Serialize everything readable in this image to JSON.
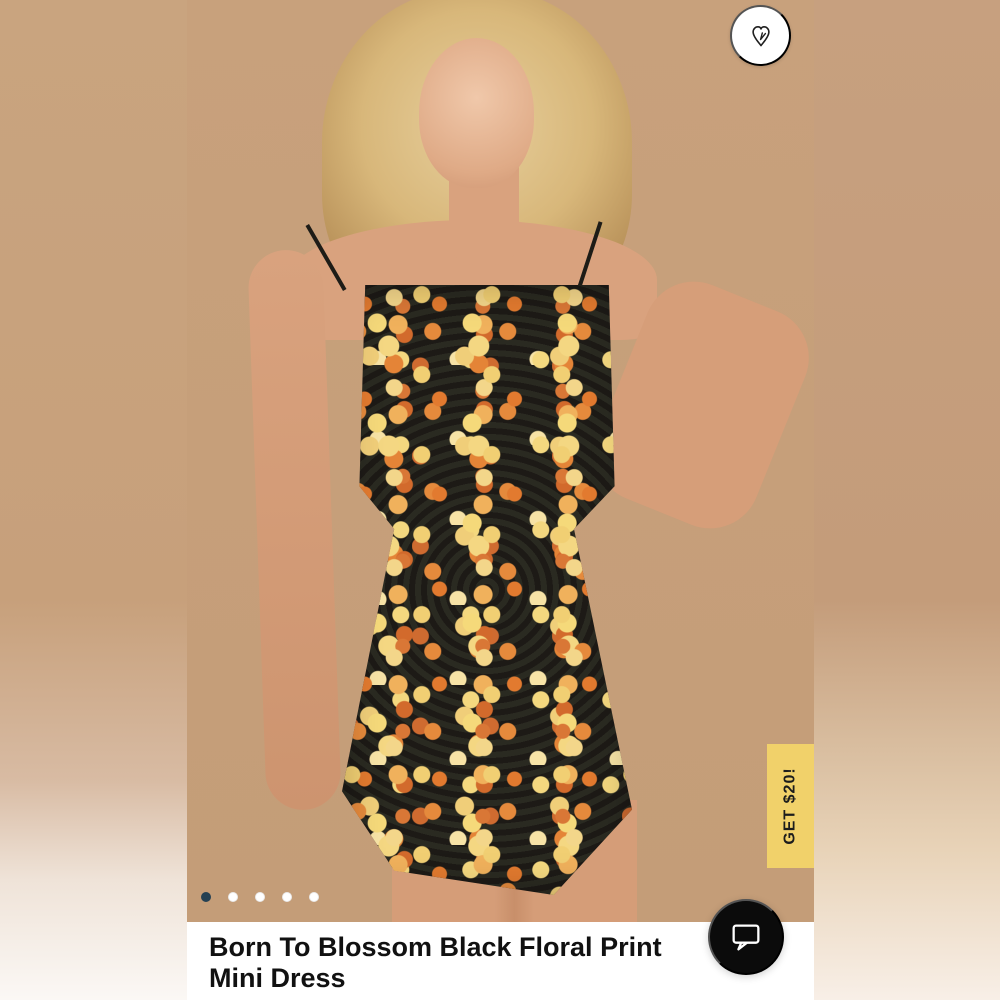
{
  "product": {
    "title": "Born To Blossom Black Floral Print Mini Dress"
  },
  "promo": {
    "label": "GET $20!"
  },
  "carousel": {
    "slides": 5,
    "active_index": 0
  },
  "icons": {
    "favorite": "heart-icon",
    "chat": "chat-bubble-icon"
  },
  "colors": {
    "promo_background": "#f1d16a",
    "active_dot": "#244053",
    "chat_button": "#0b0b0b"
  }
}
